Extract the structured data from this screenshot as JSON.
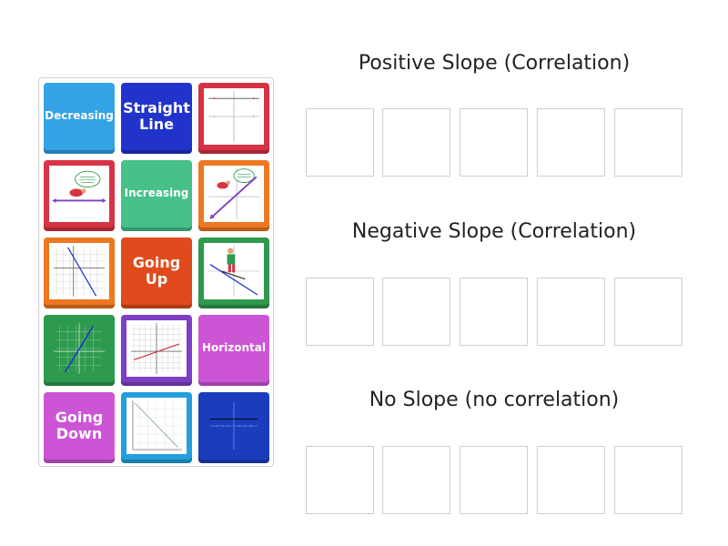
{
  "colors": {
    "lightblue": "#33a3e6",
    "darkblue": "#2233cc",
    "red": "#d63344",
    "green": "#47c08a",
    "orange": "#ee7722",
    "darkgreen": "#2e9a4e",
    "purple": "#7f3fc4",
    "pink": "#cc55d6",
    "navy": "#1c3dbb",
    "skyblue": "#22a0dd",
    "redorange": "#e14a1c"
  },
  "tiles": {
    "decreasing": "Decreasing",
    "straight_line_1": "Straight",
    "straight_line_2": "Line",
    "increasing": "Increasing",
    "going_up_1": "Going",
    "going_up_2": "Up",
    "horizontal": "Horizontal",
    "going_down_1": "Going",
    "going_down_2": "Down"
  },
  "images": {
    "horizontal_axes_graph": "horizontal-line-graph-icon",
    "turtle_horizontal": "turtle-horizontal-line-icon",
    "turtle_increasing": "turtle-increasing-line-icon",
    "grid_decreasing": "decreasing-line-grid-icon",
    "skier_decreasing": "skier-decreasing-line-icon",
    "grid_increasing_green": "increasing-line-grid-icon",
    "grid_slight_increase": "slight-increase-grid-icon",
    "diagonal_decreasing": "diagonal-decreasing-line-icon",
    "horizontal_axis": "horizontal-line-axis-icon"
  },
  "groups": [
    {
      "title": "Positive Slope (Correlation)"
    },
    {
      "title": "Negative Slope (Correlation)"
    },
    {
      "title": "No Slope (no correlation)"
    }
  ]
}
